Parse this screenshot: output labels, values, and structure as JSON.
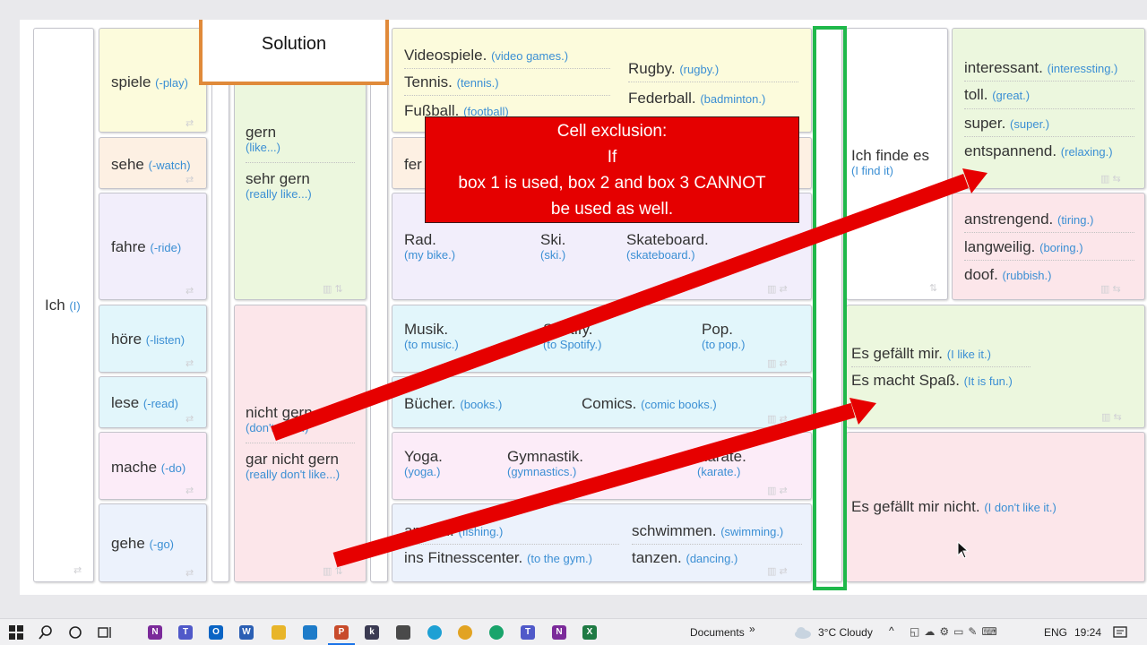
{
  "solution": "Solution",
  "subject": {
    "word": "Ich",
    "tr": "(I)"
  },
  "verbs": [
    {
      "word": "spiele",
      "tr": "(-play)"
    },
    {
      "word": "sehe",
      "tr": "(-watch)"
    },
    {
      "word": "fahre",
      "tr": "(-ride)"
    },
    {
      "word": "höre",
      "tr": "(-listen)"
    },
    {
      "word": "lese",
      "tr": "(-read)"
    },
    {
      "word": "mache",
      "tr": "(-do)"
    },
    {
      "word": "gehe",
      "tr": "(-go)"
    }
  ],
  "likes": [
    {
      "word": "gern",
      "tr": "(like...)"
    },
    {
      "word": "sehr gern",
      "tr": "(really like...)"
    },
    {
      "word": "nicht gern",
      "tr": "(don't like...)"
    },
    {
      "word": "gar nicht gern",
      "tr": "(really don't like...)"
    }
  ],
  "activities": {
    "games": [
      {
        "word": "Videospiele.",
        "tr": "(video games.)"
      },
      {
        "word": "Tennis.",
        "tr": "(tennis.)"
      },
      {
        "word": "Fußball.",
        "tr": "(football)"
      },
      {
        "word": "Rugby.",
        "tr": "(rugby.)"
      },
      {
        "word": "Federball.",
        "tr": "(badminton.)"
      }
    ],
    "tv_partial": "fer",
    "ride": [
      {
        "word": "Rad.",
        "tr": "(my bike.)"
      },
      {
        "word": "Ski.",
        "tr": "(ski.)"
      },
      {
        "word": "Skateboard.",
        "tr": "(skateboard.)"
      }
    ],
    "listen": [
      {
        "word": "Musik.",
        "tr": "(to music.)"
      },
      {
        "word": "Spotify.",
        "tr": "(to Spotify.)"
      },
      {
        "word": "Pop.",
        "tr": "(to pop.)"
      }
    ],
    "read": [
      {
        "word": "Bücher.",
        "tr": "(books.)"
      },
      {
        "word": "Comics.",
        "tr": "(comic books.)"
      }
    ],
    "do": [
      {
        "word": "Yoga.",
        "tr": "(yoga.)"
      },
      {
        "word": "Gymnastik.",
        "tr": "(gymnastics.)"
      },
      {
        "word": "Karate.",
        "tr": "(karate.)"
      }
    ],
    "go": [
      {
        "word": "angeln.",
        "tr": "(fishing.)"
      },
      {
        "word": "ins Fitnesscenter.",
        "tr": "(to the gym.)"
      },
      {
        "word": "schwimmen.",
        "tr": "(swimming.)"
      },
      {
        "word": "tanzen.",
        "tr": "(dancing.)"
      }
    ]
  },
  "finde": {
    "word": "Ich finde es",
    "tr": "(I find it)"
  },
  "adjectives": [
    {
      "word": "interessant.",
      "tr": "(interessting.)"
    },
    {
      "word": "toll.",
      "tr": "(great.)"
    },
    {
      "word": "super.",
      "tr": "(super.)"
    },
    {
      "word": "entspannend.",
      "tr": "(relaxing.)"
    },
    {
      "word": "anstrengend.",
      "tr": "(tiring.)"
    },
    {
      "word": "langweilig.",
      "tr": "(boring.)"
    },
    {
      "word": "doof.",
      "tr": "(rubbish.)"
    }
  ],
  "gefallt": [
    {
      "word": "Es gefällt mir.",
      "tr": "(I like it.)"
    },
    {
      "word": "Es macht Spaß.",
      "tr": "(It is fun.)"
    },
    {
      "word": "Es gefällt mir nicht.",
      "tr": "(I don't like it.)"
    }
  ],
  "callout": {
    "line1": "Cell exclusion:",
    "line2": "If",
    "line3": "box 1 is used, box 2  and box 3 CANNOT",
    "line4": "be used as well."
  },
  "colors": {
    "callout": "#e50000",
    "arrow": "#e60000",
    "highlight": "#1fb84a",
    "solution_border": "#e08a3a"
  },
  "taskbar": {
    "documents": "Documents",
    "weather": "3°C Cloudy",
    "lang": "ENG",
    "time": "19:24"
  }
}
